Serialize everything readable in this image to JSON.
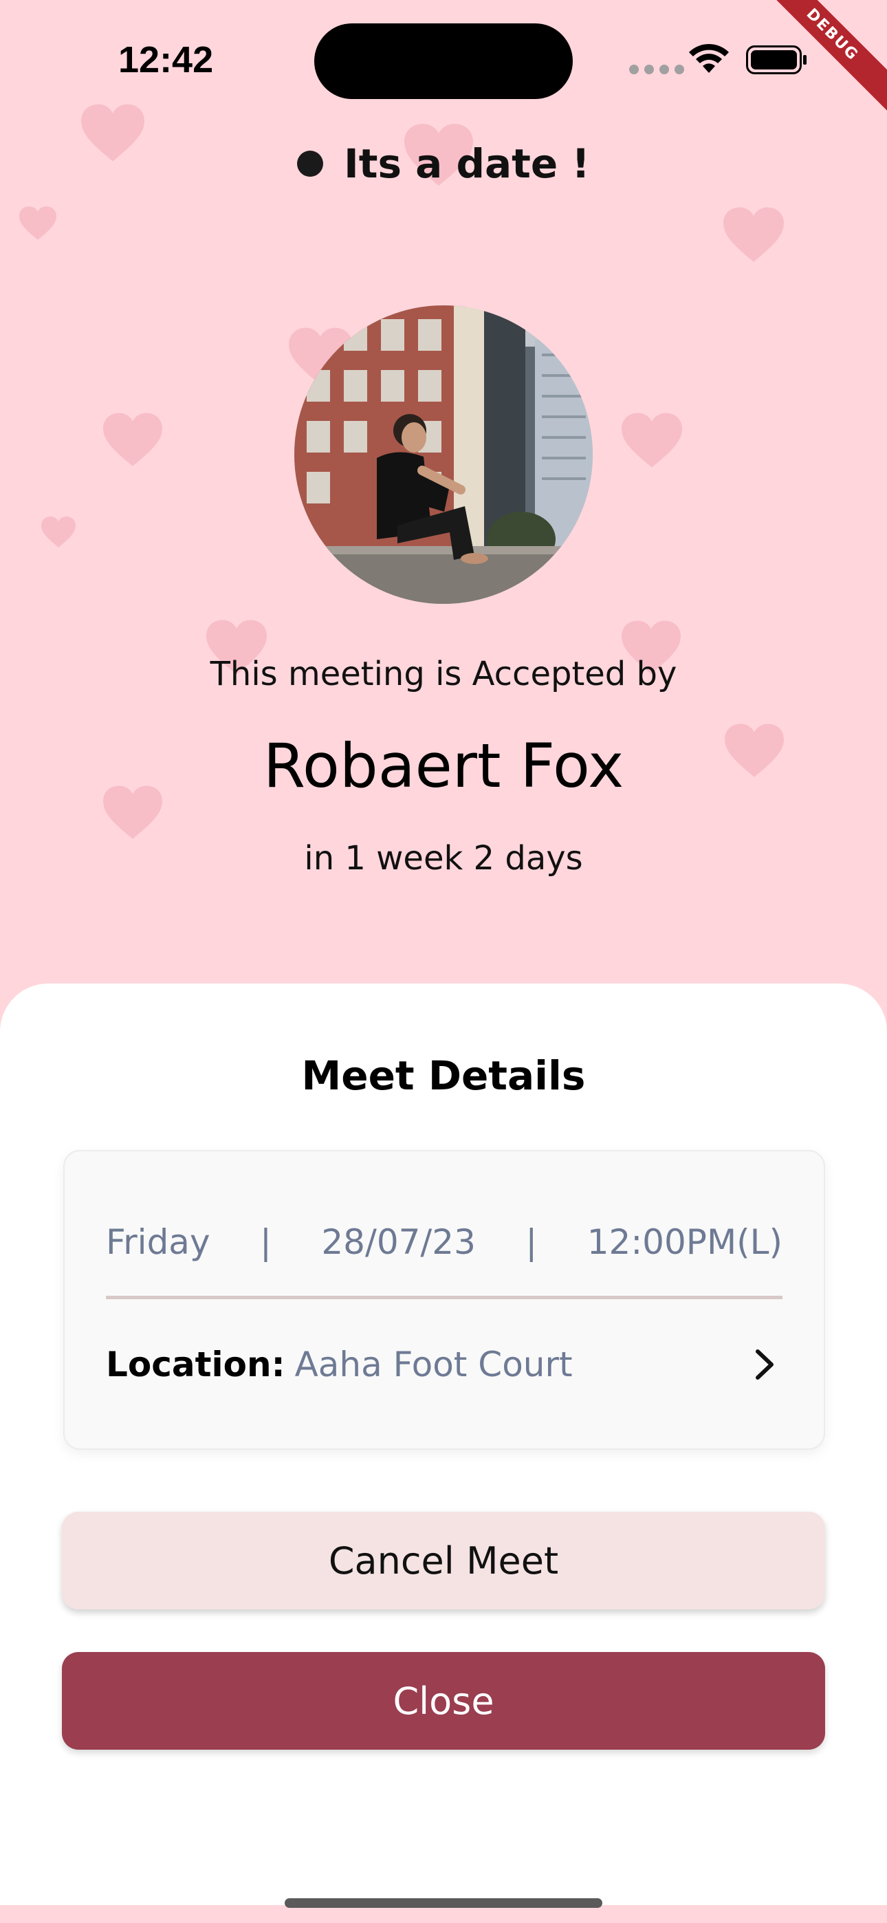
{
  "status_bar": {
    "time": "12:42",
    "debug_label": "DEBUG"
  },
  "header": {
    "title": "Its a date !"
  },
  "profile": {
    "accepted_text": "This meeting is Accepted by",
    "name": "Robaert Fox",
    "time_until": "in 1 week 2 days"
  },
  "meet_details": {
    "title": "Meet Details",
    "day": "Friday",
    "separator": "|",
    "date": "28/07/23",
    "time": "12:00PM(L)",
    "location_label": "Location:",
    "location_value": "Aaha Foot Court"
  },
  "actions": {
    "cancel_label": "Cancel Meet",
    "close_label": "Close"
  },
  "icons": {
    "wifi": "wifi-icon",
    "battery": "battery-icon",
    "chevron": "chevron-right-icon",
    "heart": "heart-icon"
  },
  "colors": {
    "background": "#FFD6DC",
    "heart": "#F7BCC6",
    "primary_button": "#9A3E50",
    "secondary_button": "#F5E3E3",
    "muted_text": "#6E7A94"
  }
}
